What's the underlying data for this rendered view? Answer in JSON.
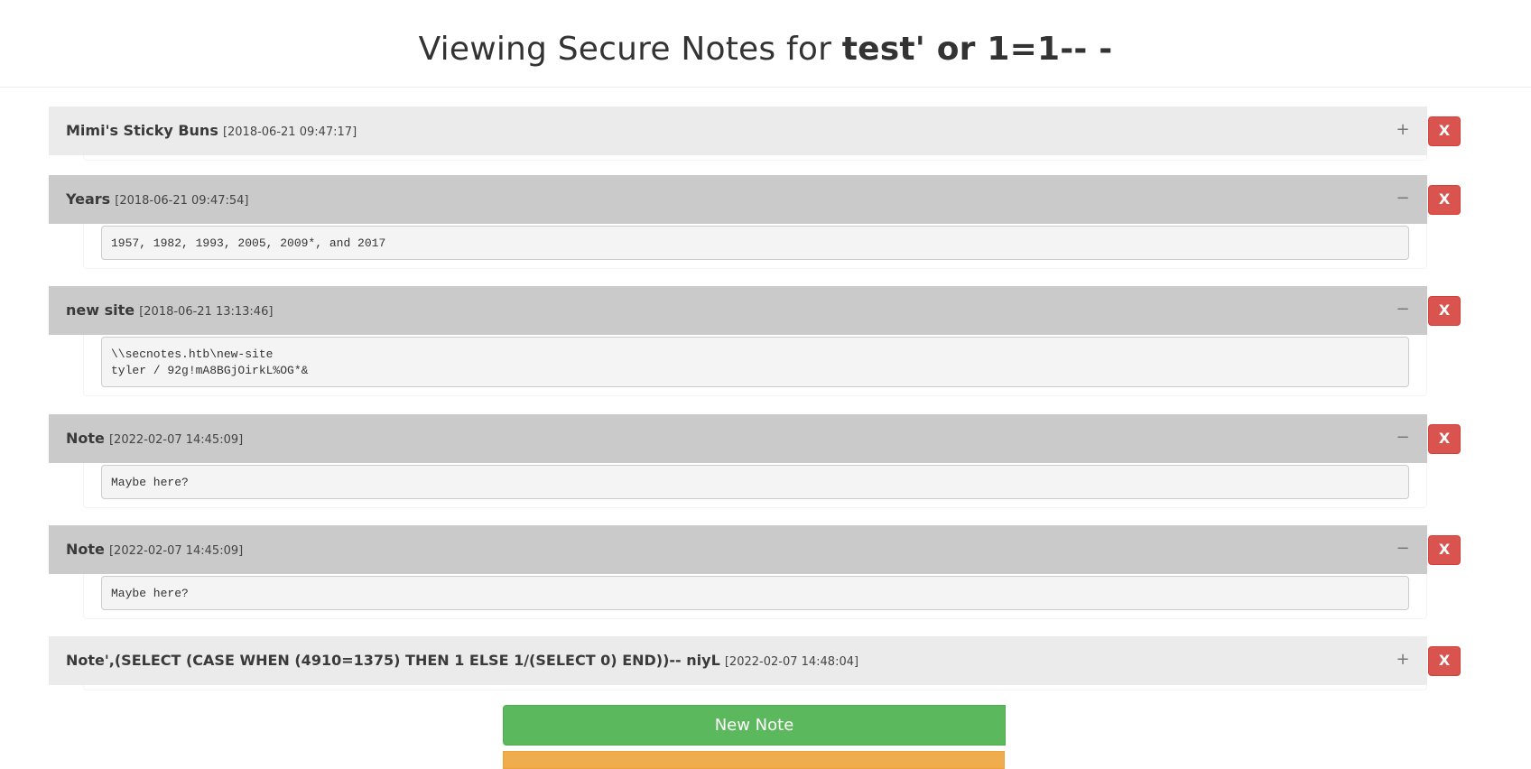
{
  "header": {
    "title_prefix": "Viewing Secure Notes for ",
    "username": "test' or 1=1-- -"
  },
  "notes": [
    {
      "title": "Mimi's Sticky Buns",
      "timestamp": "[2018-06-21 09:47:17]",
      "expanded": false,
      "toggle": "+",
      "content": "",
      "delete_label": "X"
    },
    {
      "title": "Years",
      "timestamp": "[2018-06-21 09:47:54]",
      "expanded": true,
      "toggle": "−",
      "content": "1957, 1982, 1993, 2005, 2009*, and 2017",
      "delete_label": "X"
    },
    {
      "title": "new site",
      "timestamp": "[2018-06-21 13:13:46]",
      "expanded": true,
      "toggle": "−",
      "content": "\\\\secnotes.htb\\new-site\ntyler / 92g!mA8BGjOirkL%OG*&",
      "delete_label": "X"
    },
    {
      "title": "Note",
      "timestamp": "[2022-02-07 14:45:09]",
      "expanded": true,
      "toggle": "−",
      "content": "Maybe here?",
      "delete_label": "X"
    },
    {
      "title": "Note",
      "timestamp": "[2022-02-07 14:45:09]",
      "expanded": true,
      "toggle": "−",
      "content": "Maybe here?",
      "delete_label": "X"
    },
    {
      "title": "Note',(SELECT (CASE WHEN (4910=1375) THEN 1 ELSE 1/(SELECT 0) END))-- niyL",
      "timestamp": "[2022-02-07 14:48:04]",
      "expanded": false,
      "toggle": "+",
      "content": "",
      "delete_label": "X"
    }
  ],
  "actions": {
    "new_note_label": "New Note",
    "orange_label": ""
  },
  "colors": {
    "danger": "#d9534f",
    "success": "#5cb85c",
    "warning": "#f0ad4e",
    "header_collapsed": "#ebebeb",
    "header_expanded": "#cacaca"
  }
}
